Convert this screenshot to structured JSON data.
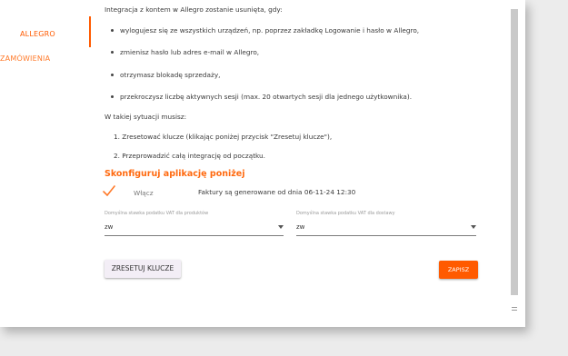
{
  "sidebar": {
    "items": [
      {
        "label": "ALLEGRO"
      },
      {
        "label": "ZAMÓWIENIA"
      }
    ]
  },
  "content": {
    "intro": "Integracja z kontem w Allegro zostanie usunięta, gdy:",
    "bullets": [
      "wylogujesz się ze wszystkich urządzeń, np. poprzez zakładkę Logowanie i hasło w Allegro,",
      "zmienisz hasło lub adres e-mail w Allegro,",
      "otrzymasz blokadę sprzedaży,",
      "przekroczysz liczbę aktywnych sesji (max. 20 otwartych sesji dla jednego użytkownika)."
    ],
    "situation": "W takiej sytuacji musisz:",
    "steps": [
      "1. Zresetować klucze (klikając poniżej przycisk \"Zresetuj klucze\"),",
      "2. Przeprowadzić całą integrację od początku."
    ],
    "section_title": "Skonfiguruj aplikację poniżej",
    "enabled_label": "Włącz",
    "invoice_info": "Faktury są generowane od dnia 06-11-24 12:30",
    "vat_products_label": "Domyślna stawka podatku VAT dla produktów",
    "vat_products_value": "zw",
    "vat_shipping_label": "Domyślna stawka podatku VAT dla dostawy",
    "vat_shipping_value": "zw",
    "reset_button": "ZRESETUJ KLUCZE",
    "save_button": "ZAPISZ"
  },
  "colors": {
    "accent": "#ff5a00",
    "check": "#ff7a2a"
  }
}
